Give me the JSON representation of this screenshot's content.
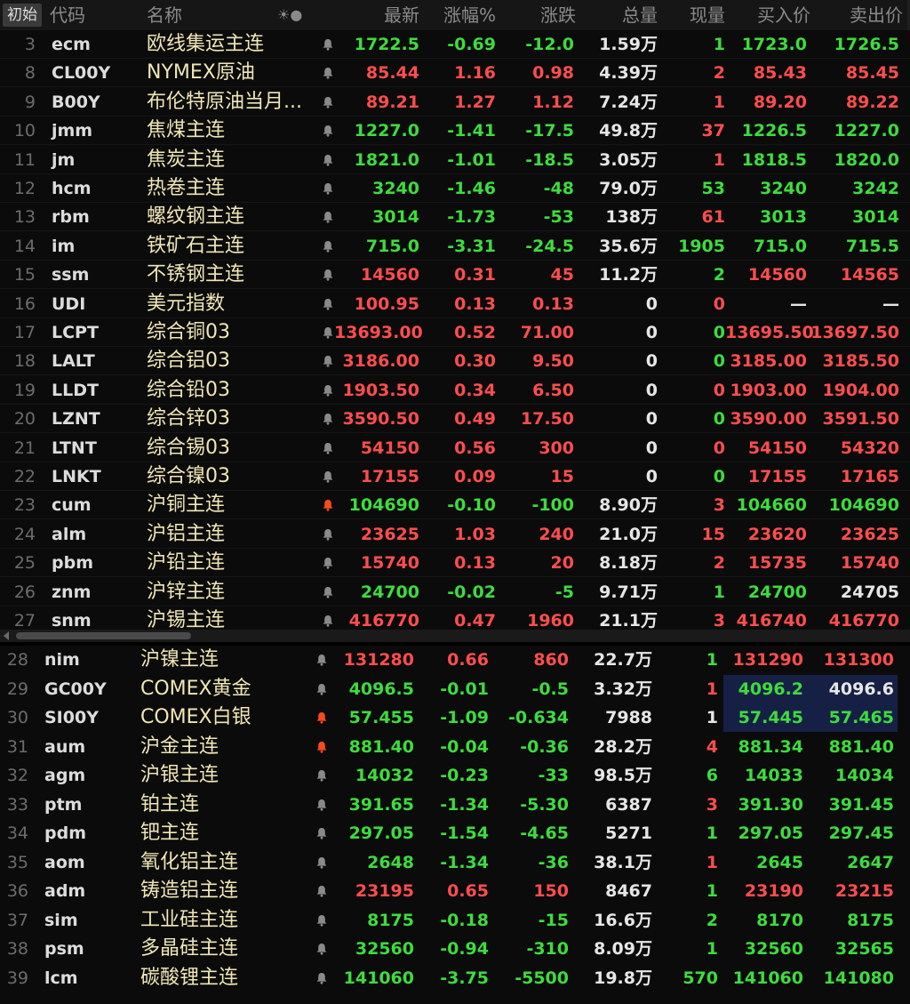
{
  "header": {
    "init_button": "初始",
    "columns": {
      "code": "代码",
      "name": "名称",
      "alert": "☀●",
      "last": "最新",
      "pct": "涨幅%",
      "chg": "涨跌",
      "vol": "总量",
      "cur": "现量",
      "bid": "买入价",
      "ask": "卖出价"
    }
  },
  "colors": {
    "up": "#ff4d4d",
    "down": "#3ddc3d",
    "name": "#f0e6b4",
    "highlight": "#162045",
    "bell_active": "#ff4a1a",
    "bell_inactive": "#8a8a8a"
  },
  "group1": [
    {
      "n": "3",
      "code": "ecm",
      "name": "欧线集运主连",
      "alert": false,
      "last": "1722.5",
      "pct": "-0.69",
      "chg": "-12.0",
      "vol": "1.59万",
      "cur": "1",
      "bid": "1723.0",
      "ask": "1726.5",
      "dir": "dn",
      "cur_dir": "dn",
      "bid_dir": "dn",
      "ask_dir": "dn"
    },
    {
      "n": "8",
      "code": "CL00Y",
      "name": "NYMEX原油",
      "alert": false,
      "last": "85.44",
      "pct": "1.16",
      "chg": "0.98",
      "vol": "4.39万",
      "cur": "2",
      "bid": "85.43",
      "ask": "85.45",
      "dir": "up",
      "cur_dir": "up",
      "bid_dir": "up",
      "ask_dir": "up"
    },
    {
      "n": "9",
      "code": "B00Y",
      "name": "布伦特原油当月...",
      "alert": false,
      "last": "89.21",
      "pct": "1.27",
      "chg": "1.12",
      "vol": "7.24万",
      "cur": "1",
      "bid": "89.20",
      "ask": "89.22",
      "dir": "up",
      "cur_dir": "up",
      "bid_dir": "up",
      "ask_dir": "up"
    },
    {
      "n": "10",
      "code": "jmm",
      "name": "焦煤主连",
      "alert": false,
      "last": "1227.0",
      "pct": "-1.41",
      "chg": "-17.5",
      "vol": "49.8万",
      "cur": "37",
      "bid": "1226.5",
      "ask": "1227.0",
      "dir": "dn",
      "cur_dir": "up",
      "bid_dir": "dn",
      "ask_dir": "dn"
    },
    {
      "n": "11",
      "code": "jm",
      "name": "焦炭主连",
      "alert": false,
      "last": "1821.0",
      "pct": "-1.01",
      "chg": "-18.5",
      "vol": "3.05万",
      "cur": "1",
      "bid": "1818.5",
      "ask": "1820.0",
      "dir": "dn",
      "cur_dir": "up",
      "bid_dir": "dn",
      "ask_dir": "dn"
    },
    {
      "n": "12",
      "code": "hcm",
      "name": "热卷主连",
      "alert": false,
      "last": "3240",
      "pct": "-1.46",
      "chg": "-48",
      "vol": "79.0万",
      "cur": "53",
      "bid": "3240",
      "ask": "3242",
      "dir": "dn",
      "cur_dir": "dn",
      "bid_dir": "dn",
      "ask_dir": "dn"
    },
    {
      "n": "13",
      "code": "rbm",
      "name": "螺纹钢主连",
      "alert": false,
      "last": "3014",
      "pct": "-1.73",
      "chg": "-53",
      "vol": "138万",
      "cur": "61",
      "bid": "3013",
      "ask": "3014",
      "dir": "dn",
      "cur_dir": "up",
      "bid_dir": "dn",
      "ask_dir": "dn"
    },
    {
      "n": "14",
      "code": "im",
      "name": "铁矿石主连",
      "alert": false,
      "last": "715.0",
      "pct": "-3.31",
      "chg": "-24.5",
      "vol": "35.6万",
      "cur": "1905",
      "bid": "715.0",
      "ask": "715.5",
      "dir": "dn",
      "cur_dir": "dn",
      "bid_dir": "dn",
      "ask_dir": "dn"
    },
    {
      "n": "15",
      "code": "ssm",
      "name": "不锈钢主连",
      "alert": false,
      "last": "14560",
      "pct": "0.31",
      "chg": "45",
      "vol": "11.2万",
      "cur": "2",
      "bid": "14560",
      "ask": "14565",
      "dir": "up",
      "cur_dir": "dn",
      "bid_dir": "up",
      "ask_dir": "up"
    },
    {
      "n": "16",
      "code": "UDI",
      "name": "美元指数",
      "alert": false,
      "last": "100.95",
      "pct": "0.13",
      "chg": "0.13",
      "vol": "0",
      "cur": "0",
      "bid": "—",
      "ask": "—",
      "dir": "up",
      "cur_dir": "up",
      "bid_dir": "wh",
      "ask_dir": "wh"
    },
    {
      "n": "17",
      "code": "LCPT",
      "name": "综合铜03",
      "alert": false,
      "last": "13693.00",
      "pct": "0.52",
      "chg": "71.00",
      "vol": "0",
      "cur": "0",
      "bid": "13695.50",
      "ask": "13697.50",
      "dir": "up",
      "cur_dir": "dn",
      "bid_dir": "up",
      "ask_dir": "up"
    },
    {
      "n": "18",
      "code": "LALT",
      "name": "综合铝03",
      "alert": false,
      "last": "3186.00",
      "pct": "0.30",
      "chg": "9.50",
      "vol": "0",
      "cur": "0",
      "bid": "3185.00",
      "ask": "3185.50",
      "dir": "up",
      "cur_dir": "dn",
      "bid_dir": "up",
      "ask_dir": "up"
    },
    {
      "n": "19",
      "code": "LLDT",
      "name": "综合铅03",
      "alert": false,
      "last": "1903.50",
      "pct": "0.34",
      "chg": "6.50",
      "vol": "0",
      "cur": "0",
      "bid": "1903.00",
      "ask": "1904.00",
      "dir": "up",
      "cur_dir": "up",
      "bid_dir": "up",
      "ask_dir": "up"
    },
    {
      "n": "20",
      "code": "LZNT",
      "name": "综合锌03",
      "alert": false,
      "last": "3590.50",
      "pct": "0.49",
      "chg": "17.50",
      "vol": "0",
      "cur": "0",
      "bid": "3590.00",
      "ask": "3591.50",
      "dir": "up",
      "cur_dir": "dn",
      "bid_dir": "up",
      "ask_dir": "up"
    },
    {
      "n": "21",
      "code": "LTNT",
      "name": "综合锡03",
      "alert": false,
      "last": "54150",
      "pct": "0.56",
      "chg": "300",
      "vol": "0",
      "cur": "0",
      "bid": "54150",
      "ask": "54320",
      "dir": "up",
      "cur_dir": "up",
      "bid_dir": "up",
      "ask_dir": "up"
    },
    {
      "n": "22",
      "code": "LNKT",
      "name": "综合镍03",
      "alert": false,
      "last": "17155",
      "pct": "0.09",
      "chg": "15",
      "vol": "0",
      "cur": "0",
      "bid": "17155",
      "ask": "17165",
      "dir": "up",
      "cur_dir": "dn",
      "bid_dir": "up",
      "ask_dir": "up"
    },
    {
      "n": "23",
      "code": "cum",
      "name": "沪铜主连",
      "alert": true,
      "last": "104690",
      "pct": "-0.10",
      "chg": "-100",
      "vol": "8.90万",
      "cur": "3",
      "bid": "104660",
      "ask": "104690",
      "dir": "dn",
      "cur_dir": "up",
      "bid_dir": "dn",
      "ask_dir": "dn"
    },
    {
      "n": "24",
      "code": "alm",
      "name": "沪铝主连",
      "alert": false,
      "last": "23625",
      "pct": "1.03",
      "chg": "240",
      "vol": "21.0万",
      "cur": "15",
      "bid": "23620",
      "ask": "23625",
      "dir": "up",
      "cur_dir": "up",
      "bid_dir": "up",
      "ask_dir": "up"
    },
    {
      "n": "25",
      "code": "pbm",
      "name": "沪铅主连",
      "alert": false,
      "last": "15740",
      "pct": "0.13",
      "chg": "20",
      "vol": "8.18万",
      "cur": "2",
      "bid": "15735",
      "ask": "15740",
      "dir": "up",
      "cur_dir": "up",
      "bid_dir": "up",
      "ask_dir": "up"
    },
    {
      "n": "26",
      "code": "znm",
      "name": "沪锌主连",
      "alert": false,
      "last": "24700",
      "pct": "-0.02",
      "chg": "-5",
      "vol": "9.71万",
      "cur": "1",
      "bid": "24700",
      "ask": "24705",
      "dir": "dn",
      "cur_dir": "dn",
      "bid_dir": "dn",
      "ask_dir": "wh"
    },
    {
      "n": "27",
      "code": "snm",
      "name": "沪锡主连",
      "alert": false,
      "last": "416770",
      "pct": "0.47",
      "chg": "1960",
      "vol": "21.1万",
      "cur": "3",
      "bid": "416740",
      "ask": "416770",
      "dir": "up",
      "cur_dir": "up",
      "bid_dir": "up",
      "ask_dir": "up"
    }
  ],
  "group2": [
    {
      "n": "28",
      "code": "nim",
      "name": "沪镍主连",
      "alert": false,
      "last": "131280",
      "pct": "0.66",
      "chg": "860",
      "vol": "22.7万",
      "cur": "1",
      "bid": "131290",
      "ask": "131300",
      "dir": "up",
      "cur_dir": "dn",
      "bid_dir": "up",
      "ask_dir": "up",
      "hl": false
    },
    {
      "n": "29",
      "code": "GC00Y",
      "name": "COMEX黄金",
      "alert": false,
      "last": "4096.5",
      "pct": "-0.01",
      "chg": "-0.5",
      "vol": "3.32万",
      "cur": "1",
      "bid": "4096.2",
      "ask": "4096.6",
      "dir": "dn",
      "cur_dir": "up",
      "bid_dir": "dn",
      "ask_dir": "wh",
      "hl": true
    },
    {
      "n": "30",
      "code": "SI00Y",
      "name": "COMEX白银",
      "alert": true,
      "last": "57.455",
      "pct": "-1.09",
      "chg": "-0.634",
      "vol": "7988",
      "cur": "1",
      "bid": "57.445",
      "ask": "57.465",
      "dir": "dn",
      "cur_dir": "wh",
      "bid_dir": "dn",
      "ask_dir": "dn",
      "hl": true
    },
    {
      "n": "31",
      "code": "aum",
      "name": "沪金主连",
      "alert": true,
      "last": "881.40",
      "pct": "-0.04",
      "chg": "-0.36",
      "vol": "28.2万",
      "cur": "4",
      "bid": "881.34",
      "ask": "881.40",
      "dir": "dn",
      "cur_dir": "up",
      "bid_dir": "dn",
      "ask_dir": "dn",
      "hl": false
    },
    {
      "n": "32",
      "code": "agm",
      "name": "沪银主连",
      "alert": false,
      "last": "14032",
      "pct": "-0.23",
      "chg": "-33",
      "vol": "98.5万",
      "cur": "6",
      "bid": "14033",
      "ask": "14034",
      "dir": "dn",
      "cur_dir": "dn",
      "bid_dir": "dn",
      "ask_dir": "dn",
      "hl": false
    },
    {
      "n": "33",
      "code": "ptm",
      "name": "铂主连",
      "alert": false,
      "last": "391.65",
      "pct": "-1.34",
      "chg": "-5.30",
      "vol": "6387",
      "cur": "3",
      "bid": "391.30",
      "ask": "391.45",
      "dir": "dn",
      "cur_dir": "up",
      "bid_dir": "dn",
      "ask_dir": "dn",
      "hl": false
    },
    {
      "n": "34",
      "code": "pdm",
      "name": "钯主连",
      "alert": false,
      "last": "297.05",
      "pct": "-1.54",
      "chg": "-4.65",
      "vol": "5271",
      "cur": "1",
      "bid": "297.05",
      "ask": "297.45",
      "dir": "dn",
      "cur_dir": "dn",
      "bid_dir": "dn",
      "ask_dir": "dn",
      "hl": false
    },
    {
      "n": "35",
      "code": "aom",
      "name": "氧化铝主连",
      "alert": false,
      "last": "2648",
      "pct": "-1.34",
      "chg": "-36",
      "vol": "38.1万",
      "cur": "1",
      "bid": "2645",
      "ask": "2647",
      "dir": "dn",
      "cur_dir": "up",
      "bid_dir": "dn",
      "ask_dir": "dn",
      "hl": false
    },
    {
      "n": "36",
      "code": "adm",
      "name": "铸造铝主连",
      "alert": false,
      "last": "23195",
      "pct": "0.65",
      "chg": "150",
      "vol": "8467",
      "cur": "1",
      "bid": "23190",
      "ask": "23215",
      "dir": "up",
      "cur_dir": "dn",
      "bid_dir": "up",
      "ask_dir": "up",
      "hl": false
    },
    {
      "n": "37",
      "code": "sim",
      "name": "工业硅主连",
      "alert": false,
      "last": "8175",
      "pct": "-0.18",
      "chg": "-15",
      "vol": "16.6万",
      "cur": "2",
      "bid": "8170",
      "ask": "8175",
      "dir": "dn",
      "cur_dir": "dn",
      "bid_dir": "dn",
      "ask_dir": "dn",
      "hl": false
    },
    {
      "n": "38",
      "code": "psm",
      "name": "多晶硅主连",
      "alert": false,
      "last": "32560",
      "pct": "-0.94",
      "chg": "-310",
      "vol": "8.09万",
      "cur": "1",
      "bid": "32560",
      "ask": "32565",
      "dir": "dn",
      "cur_dir": "dn",
      "bid_dir": "dn",
      "ask_dir": "dn",
      "hl": false
    },
    {
      "n": "39",
      "code": "lcm",
      "name": "碳酸锂主连",
      "alert": false,
      "last": "141060",
      "pct": "-3.75",
      "chg": "-5500",
      "vol": "19.8万",
      "cur": "570",
      "bid": "141060",
      "ask": "141080",
      "dir": "dn",
      "cur_dir": "dn",
      "bid_dir": "dn",
      "ask_dir": "dn",
      "hl": false
    }
  ]
}
